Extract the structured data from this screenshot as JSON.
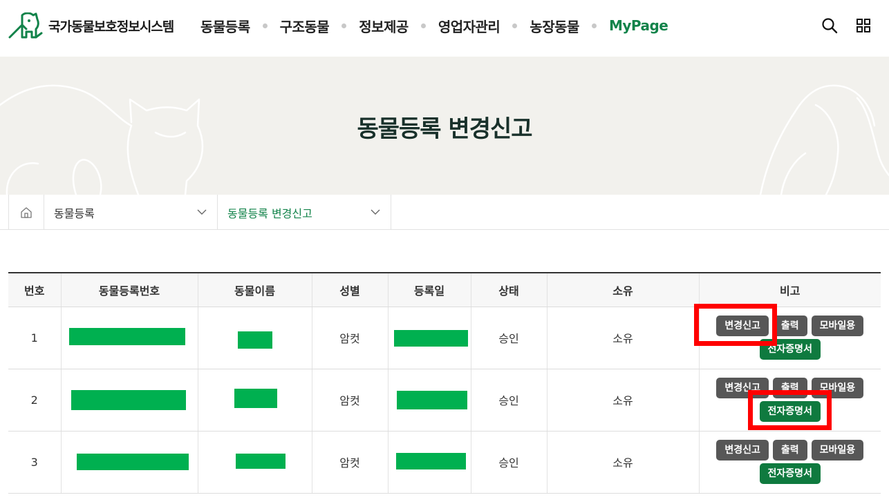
{
  "header": {
    "site_name": "국가동물보호정보시스템",
    "nav": [
      {
        "label": "동물등록",
        "active": false
      },
      {
        "label": "구조동물",
        "active": false
      },
      {
        "label": "정보제공",
        "active": false
      },
      {
        "label": "영업자관리",
        "active": false
      },
      {
        "label": "농장동물",
        "active": false
      },
      {
        "label": "MyPage",
        "active": true
      }
    ],
    "icons": [
      "search-icon",
      "grid-menu-icon"
    ]
  },
  "banner": {
    "title": "동물등록 변경신고"
  },
  "breadcrumb": {
    "home_icon": "home-icon",
    "level1": "동물등록",
    "level2": "동물등록 변경신고"
  },
  "table": {
    "columns": [
      "번호",
      "동물등록번호",
      "동물이름",
      "성별",
      "등록일",
      "상태",
      "소유",
      "비고"
    ],
    "rows": [
      {
        "no": "1",
        "sex": "암컷",
        "status": "승인",
        "own": "소유"
      },
      {
        "no": "2",
        "sex": "암컷",
        "status": "승인",
        "own": "소유"
      },
      {
        "no": "3",
        "sex": "암컷",
        "status": "승인",
        "own": "소유"
      }
    ],
    "buttons": {
      "change": "변경신고",
      "print": "출력",
      "mobile": "모바일용",
      "certificate": "전자증명서"
    }
  },
  "colors": {
    "accent_green": "#12834a",
    "redaction": "#00b050",
    "highlight_red": "#ff0000",
    "button_gray": "#575757",
    "button_green": "#0f7a3f",
    "banner_bg": "#f2f1ed"
  }
}
